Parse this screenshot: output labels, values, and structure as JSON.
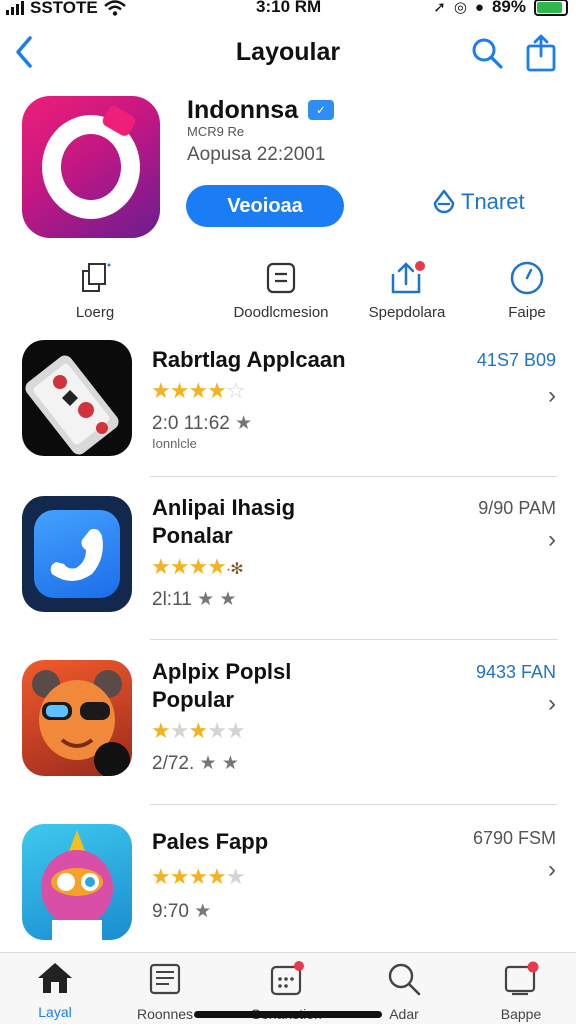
{
  "status_bar": {
    "carrier": "SSTOTE",
    "time": "3:10 RM",
    "battery_percent": "89%",
    "battery_level": 0.89,
    "battery_color": "#2eb84b"
  },
  "nav": {
    "title": "Layoular",
    "back_icon": "chevron-left-icon",
    "search_icon": "search-icon",
    "share_icon": "share-icon"
  },
  "featured": {
    "name": "Indonnsa",
    "subtitle": "MCR9 Re",
    "meta": "Aopusa 22:2001",
    "get_label": "Veoioaa",
    "link_label": "Tnaret",
    "accent": "#1b7df3"
  },
  "actions": [
    {
      "icon": "copy-icon",
      "label": "Loerg"
    },
    {
      "icon": "document-icon",
      "label": "Doodlcmesion"
    },
    {
      "icon": "upload-icon",
      "label": "Spepdolara"
    },
    {
      "icon": "compass-icon",
      "label": "Faipe"
    }
  ],
  "apps": [
    {
      "name_line1": "Rabrtlag Applcaan",
      "name_line2": "",
      "right_value": "41S7 B09",
      "stars": 4,
      "rating": "2:0 11:62",
      "sub": "Ionnlcle"
    },
    {
      "name_line1": "Anlipai Ihasig",
      "name_line2": "Ponalar",
      "right_value": "9/90 PAM",
      "stars": 4,
      "rating": "2l:11",
      "sub": ""
    },
    {
      "name_line1": "Aplpix Poplsl",
      "name_line2": "Popular",
      "right_value": "9433 FAN",
      "stars": 2,
      "rating": "2/72.",
      "sub": ""
    },
    {
      "name_line1": "Pales Fapp",
      "name_line2": "",
      "right_value": "6790 FSM",
      "stars": 4,
      "rating": "9:70",
      "sub": ""
    }
  ],
  "tabs": [
    {
      "icon": "home-icon",
      "label": "Layal",
      "active": true
    },
    {
      "icon": "news-icon",
      "label": "Roonnes",
      "active": false
    },
    {
      "icon": "calendar-icon",
      "label": "Gonanstion",
      "active": false
    },
    {
      "icon": "search-icon",
      "label": "Adar",
      "active": false
    },
    {
      "icon": "tablet-icon",
      "label": "Bappe",
      "active": false
    }
  ]
}
